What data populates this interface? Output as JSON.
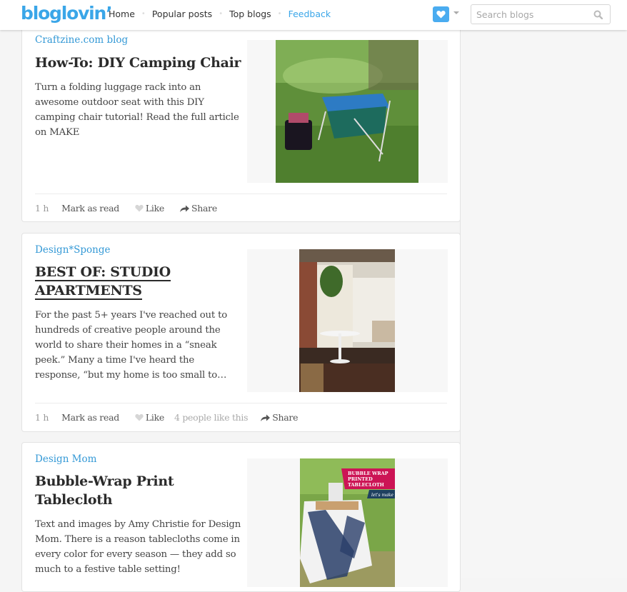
{
  "header": {
    "logo": "bloglovin’",
    "nav": [
      {
        "label": "Home"
      },
      {
        "label": "Popular posts"
      },
      {
        "label": "Top blogs"
      },
      {
        "label": "Feedback"
      }
    ],
    "search_placeholder": "Search blogs",
    "search_value": ""
  },
  "colors": {
    "brand": "#3aa6e8",
    "heart_button": "#4aacf0",
    "blog_link": "#3499d6",
    "title_text": "#2b2b2b",
    "background": "#f5f5f5"
  },
  "posts": [
    {
      "blog": "Craftzine.com blog",
      "title": "How-To: DIY Camping Chair",
      "excerpt": "Turn a folding luggage rack into an awesome outdoor seat with this DIY camping chair tutorial! Read the full article on MAKE",
      "image_alt": "Blue folding camping chair on grass next to a bucket of bottles",
      "time": "1 h",
      "mark_as_read": "Mark as read",
      "like": "Like",
      "likes_count": "",
      "share": "Share"
    },
    {
      "blog": "Design*Sponge",
      "title": "BEST OF: STUDIO APARTMENTS",
      "excerpt": "For the past 5+ years I've reached out to hundreds of creative people around the world to share their homes in a “sneak peek.” Many a time I've heard the response, “but my home is too small to…",
      "image_alt": "Studio apartment with curtain divider, hanging plant and round white table",
      "time": "1 h",
      "mark_as_read": "Mark as read",
      "like": "Like",
      "likes_count": "4 people like this",
      "share": "Share"
    },
    {
      "blog": "Design Mom",
      "title": "Bubble-Wrap Print Tablecloth",
      "excerpt": "Text and images by Amy Christie for Design Mom.  There is a reason tablecloths come in every color for every season — they add so much to a festive table setting!",
      "image_alt": "Table with bubble-wrap printed tablecloth",
      "image_banner": [
        "BUBBLE WRAP",
        "PRINTED",
        "TABLECLOTH"
      ],
      "image_tag": "let's make it!"
    }
  ]
}
